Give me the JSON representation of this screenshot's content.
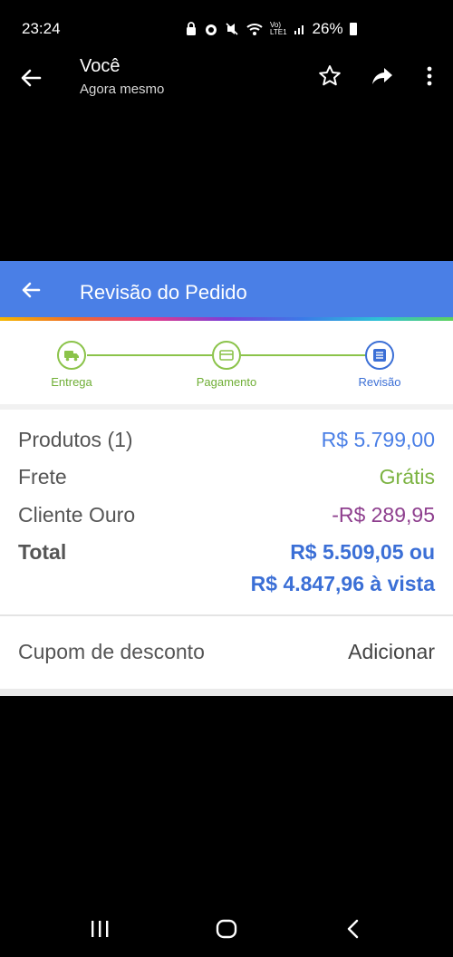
{
  "status_bar": {
    "time": "23:24",
    "battery": "26%"
  },
  "viewer": {
    "title": "Você",
    "subtitle": "Agora mesmo"
  },
  "app": {
    "title": "Revisão do Pedido",
    "accent": "#4a7fe6",
    "steps": [
      {
        "label": "Entrega",
        "icon": "truck-icon",
        "color": "#8bc34a"
      },
      {
        "label": "Pagamento",
        "icon": "card-icon",
        "color": "#8bc34a"
      },
      {
        "label": "Revisão",
        "icon": "list-icon",
        "color": "#3b6fd6"
      }
    ]
  },
  "summary": {
    "products_label": "Produtos (1)",
    "products_value": "R$ 5.799,00",
    "shipping_label": "Frete",
    "shipping_value": "Grátis",
    "discount_label": "Cliente Ouro",
    "discount_value": "-R$ 289,95",
    "total_label": "Total",
    "total_value_line1": "R$ 5.509,05 ou",
    "total_value_line2": "R$ 4.847,96 à vista"
  },
  "coupon": {
    "label": "Cupom de desconto",
    "action": "Adicionar"
  }
}
